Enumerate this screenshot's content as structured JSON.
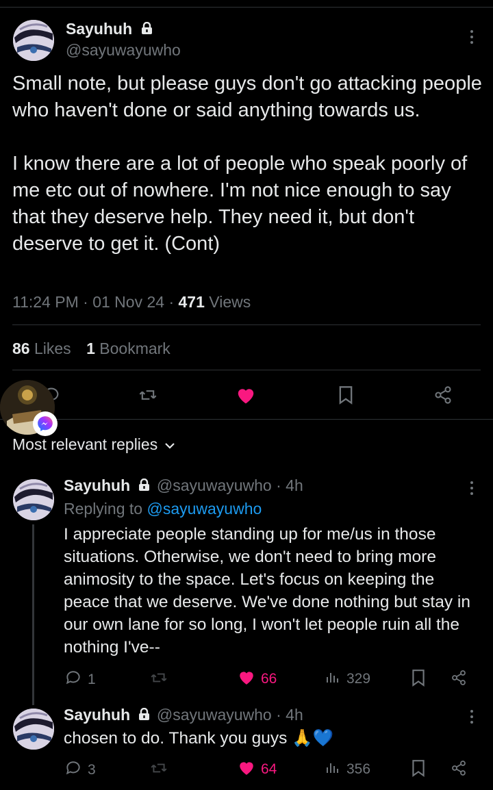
{
  "post": {
    "author_name": "Sayuhuh",
    "author_handle": "@sayuwayuwho",
    "text": "Small note, but please guys don't go attacking people who haven't done or said anything towards us.\n\nI know there are a lot of people who speak poorly of me etc out of nowhere. I'm not nice enough to say that they deserve help. They need it, but don't deserve to get it. (Cont)",
    "time": "11:24 PM",
    "date": "01 Nov 24",
    "views_count": "471",
    "views_label": "Views",
    "likes_count": "86",
    "likes_label": "Likes",
    "bookmarks_count": "1",
    "bookmarks_label": "Bookmark"
  },
  "sort": {
    "label": "Most relevant replies"
  },
  "replies": [
    {
      "author_name": "Sayuhuh",
      "author_handle": "@sayuwayuwho",
      "age": "· 4h",
      "replying_prefix": "Replying to",
      "replying_to": "@sayuwayuwho",
      "text": "I appreciate people standing up for me/us in those situations. Otherwise, we don't need to bring more animosity to the space. Let's focus on keeping the peace that we deserve. We've done nothing but stay in our own lane for so long, I won't let people ruin all the nothing I've--",
      "reply_count": "1",
      "like_count": "66",
      "view_count": "329"
    },
    {
      "author_name": "Sayuhuh",
      "author_handle": "@sayuwayuwho",
      "age": "· 4h",
      "text": "chosen to do. Thank you guys 🙏💙",
      "reply_count": "3",
      "like_count": "64",
      "view_count": "356"
    }
  ],
  "colors": {
    "background": "#000000",
    "text": "#e7e9ea",
    "muted": "#71767b",
    "link": "#1d9bf0",
    "like": "#f91880",
    "divider": "#2f3336"
  }
}
